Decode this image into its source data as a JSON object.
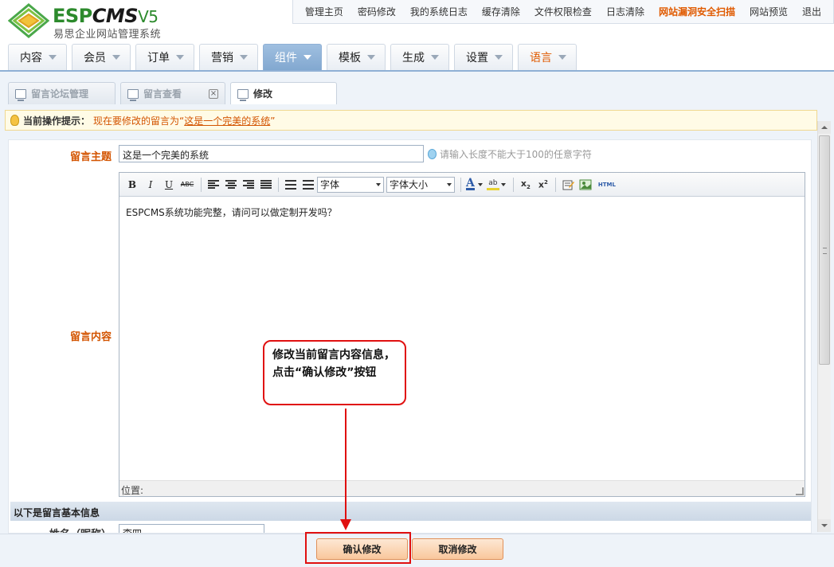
{
  "brand": {
    "name_part1": "ESP",
    "name_part2": "CMS",
    "name_part3": "V5",
    "subtitle": "易思企业网站管理系统"
  },
  "top_links": [
    {
      "label": "管理主页",
      "highlight": false
    },
    {
      "label": "密码修改",
      "highlight": false
    },
    {
      "label": "我的系统日志",
      "highlight": false
    },
    {
      "label": "缓存清除",
      "highlight": false
    },
    {
      "label": "文件权限检查",
      "highlight": false
    },
    {
      "label": "日志清除",
      "highlight": false
    },
    {
      "label": "网站漏洞安全扫描",
      "highlight": true
    },
    {
      "label": "网站预览",
      "highlight": false
    },
    {
      "label": "退出",
      "highlight": false
    }
  ],
  "main_nav": [
    {
      "label": "内容"
    },
    {
      "label": "会员"
    },
    {
      "label": "订单"
    },
    {
      "label": "营销"
    },
    {
      "label": "组件",
      "active": true
    },
    {
      "label": "模板"
    },
    {
      "label": "生成"
    },
    {
      "label": "设置"
    },
    {
      "label": "语言",
      "lang": true
    }
  ],
  "tabs": [
    {
      "label": "留言论坛管理"
    },
    {
      "label": "留言查看"
    },
    {
      "label": "修改",
      "active": true
    }
  ],
  "tip": {
    "label": "当前操作提示：",
    "message_prefix": "现在要修改的留言为“",
    "message_subject": "这是一个完美的系统",
    "message_suffix": "”"
  },
  "form": {
    "subject_label": "留言主题",
    "subject_value": "这是一个完美的系统",
    "subject_hint": "请输入长度不能大于100的任意字符",
    "content_label": "留言内容",
    "content_value": "ESPCMS系统功能完整，请问可以做定制开发吗？",
    "font_select": "字体",
    "size_select": "字体大小",
    "position_label": "位置:",
    "section_title": "以下是留言基本信息",
    "name_label": "姓名（昵称）",
    "name_value": "李四"
  },
  "buttons": {
    "confirm": "确认修改",
    "cancel": "取消修改"
  },
  "annotation": {
    "text": "修改当前留言内容信息，点击“确认修改”按钮"
  },
  "colors": {
    "accent_orange": "#d35400",
    "nav_active": "#82a8d0",
    "annotation_red": "#e01010"
  }
}
